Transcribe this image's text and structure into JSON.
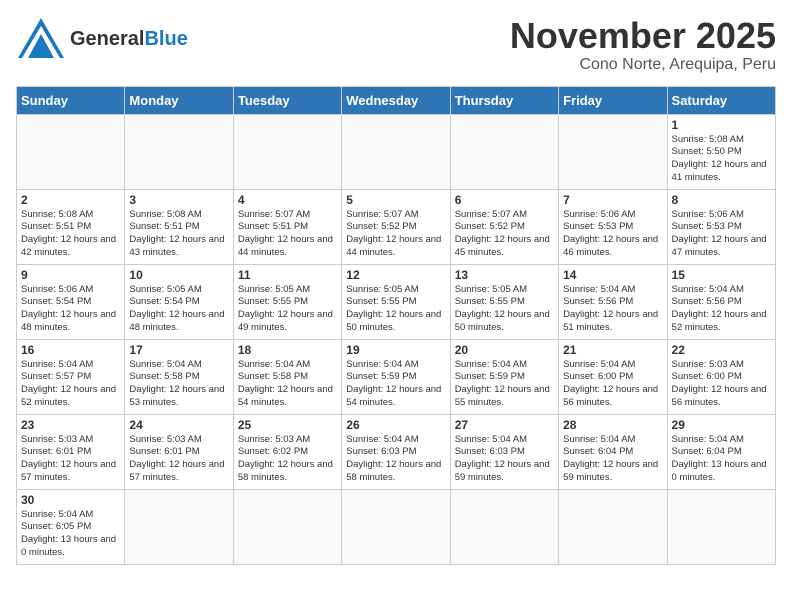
{
  "header": {
    "logo_general": "General",
    "logo_blue": "Blue",
    "title": "November 2025",
    "location": "Cono Norte, Arequipa, Peru"
  },
  "days_of_week": [
    "Sunday",
    "Monday",
    "Tuesday",
    "Wednesday",
    "Thursday",
    "Friday",
    "Saturday"
  ],
  "weeks": [
    [
      {
        "day": "",
        "info": ""
      },
      {
        "day": "",
        "info": ""
      },
      {
        "day": "",
        "info": ""
      },
      {
        "day": "",
        "info": ""
      },
      {
        "day": "",
        "info": ""
      },
      {
        "day": "",
        "info": ""
      },
      {
        "day": "1",
        "info": "Sunrise: 5:08 AM\nSunset: 5:50 PM\nDaylight: 12 hours and 41 minutes."
      }
    ],
    [
      {
        "day": "2",
        "info": "Sunrise: 5:08 AM\nSunset: 5:51 PM\nDaylight: 12 hours and 42 minutes."
      },
      {
        "day": "3",
        "info": "Sunrise: 5:08 AM\nSunset: 5:51 PM\nDaylight: 12 hours and 43 minutes."
      },
      {
        "day": "4",
        "info": "Sunrise: 5:07 AM\nSunset: 5:51 PM\nDaylight: 12 hours and 44 minutes."
      },
      {
        "day": "5",
        "info": "Sunrise: 5:07 AM\nSunset: 5:52 PM\nDaylight: 12 hours and 44 minutes."
      },
      {
        "day": "6",
        "info": "Sunrise: 5:07 AM\nSunset: 5:52 PM\nDaylight: 12 hours and 45 minutes."
      },
      {
        "day": "7",
        "info": "Sunrise: 5:06 AM\nSunset: 5:53 PM\nDaylight: 12 hours and 46 minutes."
      },
      {
        "day": "8",
        "info": "Sunrise: 5:06 AM\nSunset: 5:53 PM\nDaylight: 12 hours and 47 minutes."
      }
    ],
    [
      {
        "day": "9",
        "info": "Sunrise: 5:06 AM\nSunset: 5:54 PM\nDaylight: 12 hours and 48 minutes."
      },
      {
        "day": "10",
        "info": "Sunrise: 5:05 AM\nSunset: 5:54 PM\nDaylight: 12 hours and 48 minutes."
      },
      {
        "day": "11",
        "info": "Sunrise: 5:05 AM\nSunset: 5:55 PM\nDaylight: 12 hours and 49 minutes."
      },
      {
        "day": "12",
        "info": "Sunrise: 5:05 AM\nSunset: 5:55 PM\nDaylight: 12 hours and 50 minutes."
      },
      {
        "day": "13",
        "info": "Sunrise: 5:05 AM\nSunset: 5:55 PM\nDaylight: 12 hours and 50 minutes."
      },
      {
        "day": "14",
        "info": "Sunrise: 5:04 AM\nSunset: 5:56 PM\nDaylight: 12 hours and 51 minutes."
      },
      {
        "day": "15",
        "info": "Sunrise: 5:04 AM\nSunset: 5:56 PM\nDaylight: 12 hours and 52 minutes."
      }
    ],
    [
      {
        "day": "16",
        "info": "Sunrise: 5:04 AM\nSunset: 5:57 PM\nDaylight: 12 hours and 52 minutes."
      },
      {
        "day": "17",
        "info": "Sunrise: 5:04 AM\nSunset: 5:58 PM\nDaylight: 12 hours and 53 minutes."
      },
      {
        "day": "18",
        "info": "Sunrise: 5:04 AM\nSunset: 5:58 PM\nDaylight: 12 hours and 54 minutes."
      },
      {
        "day": "19",
        "info": "Sunrise: 5:04 AM\nSunset: 5:59 PM\nDaylight: 12 hours and 54 minutes."
      },
      {
        "day": "20",
        "info": "Sunrise: 5:04 AM\nSunset: 5:59 PM\nDaylight: 12 hours and 55 minutes."
      },
      {
        "day": "21",
        "info": "Sunrise: 5:04 AM\nSunset: 6:00 PM\nDaylight: 12 hours and 56 minutes."
      },
      {
        "day": "22",
        "info": "Sunrise: 5:03 AM\nSunset: 6:00 PM\nDaylight: 12 hours and 56 minutes."
      }
    ],
    [
      {
        "day": "23",
        "info": "Sunrise: 5:03 AM\nSunset: 6:01 PM\nDaylight: 12 hours and 57 minutes."
      },
      {
        "day": "24",
        "info": "Sunrise: 5:03 AM\nSunset: 6:01 PM\nDaylight: 12 hours and 57 minutes."
      },
      {
        "day": "25",
        "info": "Sunrise: 5:03 AM\nSunset: 6:02 PM\nDaylight: 12 hours and 58 minutes."
      },
      {
        "day": "26",
        "info": "Sunrise: 5:04 AM\nSunset: 6:03 PM\nDaylight: 12 hours and 58 minutes."
      },
      {
        "day": "27",
        "info": "Sunrise: 5:04 AM\nSunset: 6:03 PM\nDaylight: 12 hours and 59 minutes."
      },
      {
        "day": "28",
        "info": "Sunrise: 5:04 AM\nSunset: 6:04 PM\nDaylight: 12 hours and 59 minutes."
      },
      {
        "day": "29",
        "info": "Sunrise: 5:04 AM\nSunset: 6:04 PM\nDaylight: 13 hours and 0 minutes."
      }
    ],
    [
      {
        "day": "30",
        "info": "Sunrise: 5:04 AM\nSunset: 6:05 PM\nDaylight: 13 hours and 0 minutes."
      },
      {
        "day": "",
        "info": ""
      },
      {
        "day": "",
        "info": ""
      },
      {
        "day": "",
        "info": ""
      },
      {
        "day": "",
        "info": ""
      },
      {
        "day": "",
        "info": ""
      },
      {
        "day": "",
        "info": ""
      }
    ]
  ]
}
